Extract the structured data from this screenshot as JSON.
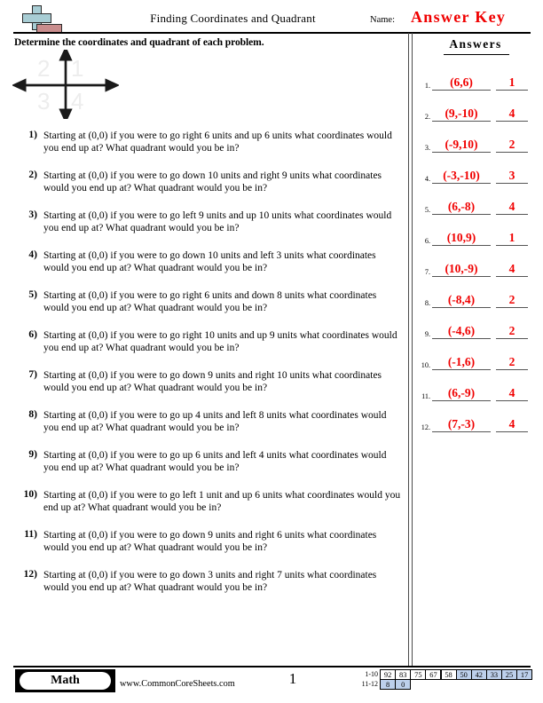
{
  "header": {
    "logo_icon": "plus-block-logo",
    "title": "Finding Coordinates and Quadrant",
    "name_label": "Name:",
    "answer_key_stamp": "Answer Key"
  },
  "instruction": "Determine the coordinates and quadrant of each problem.",
  "quadrant_diagram": {
    "icon": "coordinate-axes-icon",
    "quadrant_top_left": "2",
    "quadrant_top_right": "1",
    "quadrant_bottom_left": "3",
    "quadrant_bottom_right": "4"
  },
  "questions": [
    {
      "number": "1)",
      "text": "Starting at (0,0) if you were to go right 6 units and up 6 units what coordinates would you end up at? What quadrant would you be in?"
    },
    {
      "number": "2)",
      "text": "Starting at (0,0) if you were to go down 10 units and right 9 units what coordinates would you end up at? What quadrant would you be in?"
    },
    {
      "number": "3)",
      "text": "Starting at (0,0) if you were to go left 9 units and up 10 units what coordinates would you end up at? What quadrant would you be in?"
    },
    {
      "number": "4)",
      "text": "Starting at (0,0) if you were to go down 10 units and left 3 units what coordinates would you end up at? What quadrant would you be in?"
    },
    {
      "number": "5)",
      "text": "Starting at (0,0) if you were to go right 6 units and down 8 units what coordinates would you end up at? What quadrant would you be in?"
    },
    {
      "number": "6)",
      "text": "Starting at (0,0) if you were to go right 10 units and up 9 units what coordinates would you end up at? What quadrant would you be in?"
    },
    {
      "number": "7)",
      "text": "Starting at (0,0) if you were to go down 9 units and right 10 units what coordinates would you end up at? What quadrant would you be in?"
    },
    {
      "number": "8)",
      "text": "Starting at (0,0) if you were to go up 4 units and left 8 units what coordinates would you end up at? What quadrant would you be in?"
    },
    {
      "number": "9)",
      "text": "Starting at (0,0) if you were to go up 6 units and left 4 units what coordinates would you end up at? What quadrant would you be in?"
    },
    {
      "number": "10)",
      "text": "Starting at (0,0) if you were to go left 1 unit and up 6 units what coordinates would you end up at? What quadrant would you be in?"
    },
    {
      "number": "11)",
      "text": "Starting at (0,0) if you were to go down 9 units and right 6 units what coordinates would you end up at? What quadrant would you be in?"
    },
    {
      "number": "12)",
      "text": "Starting at (0,0) if you were to go down 3 units and right 7 units what coordinates would you end up at? What quadrant would you be in?"
    }
  ],
  "answers_panel": {
    "heading": "Answers",
    "accent_color": "#f00000",
    "rows": [
      {
        "index": "1.",
        "coordinate": "(6,6)",
        "quadrant": "1"
      },
      {
        "index": "2.",
        "coordinate": "(9,-10)",
        "quadrant": "4"
      },
      {
        "index": "3.",
        "coordinate": "(-9,10)",
        "quadrant": "2"
      },
      {
        "index": "4.",
        "coordinate": "(-3,-10)",
        "quadrant": "3"
      },
      {
        "index": "5.",
        "coordinate": "(6,-8)",
        "quadrant": "4"
      },
      {
        "index": "6.",
        "coordinate": "(10,9)",
        "quadrant": "1"
      },
      {
        "index": "7.",
        "coordinate": "(10,-9)",
        "quadrant": "4"
      },
      {
        "index": "8.",
        "coordinate": "(-8,4)",
        "quadrant": "2"
      },
      {
        "index": "9.",
        "coordinate": "(-4,6)",
        "quadrant": "2"
      },
      {
        "index": "10.",
        "coordinate": "(-1,6)",
        "quadrant": "2"
      },
      {
        "index": "11.",
        "coordinate": "(6,-9)",
        "quadrant": "4"
      },
      {
        "index": "12.",
        "coordinate": "(7,-3)",
        "quadrant": "4"
      }
    ]
  },
  "footer": {
    "subject_badge": "Math",
    "site_url": "www.CommonCoreSheets.com",
    "page_number": "1",
    "score_table": {
      "shade_color": "#bdd0ec",
      "rows": [
        {
          "label": "1-10",
          "cells": [
            {
              "value": "92",
              "shaded": false
            },
            {
              "value": "83",
              "shaded": false
            },
            {
              "value": "75",
              "shaded": false
            },
            {
              "value": "67",
              "shaded": false
            },
            {
              "value": "58",
              "shaded": false
            },
            {
              "value": "50",
              "shaded": true
            },
            {
              "value": "42",
              "shaded": true
            },
            {
              "value": "33",
              "shaded": true
            },
            {
              "value": "25",
              "shaded": true
            },
            {
              "value": "17",
              "shaded": true
            }
          ]
        },
        {
          "label": "11-12",
          "cells": [
            {
              "value": "8",
              "shaded": true
            },
            {
              "value": "0",
              "shaded": true
            }
          ]
        }
      ]
    }
  }
}
